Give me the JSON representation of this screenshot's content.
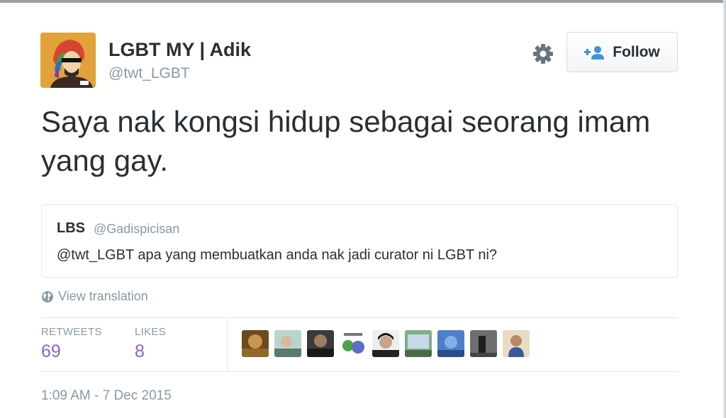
{
  "author": {
    "name": "LGBT MY | Adik",
    "handle": "@twt_LGBT"
  },
  "actions": {
    "follow_label": "Follow"
  },
  "tweet": {
    "text": "Saya nak kongsi hidup sebagai seorang imam yang gay."
  },
  "quoted_tweet": {
    "name": "LBS",
    "handle": "@Gadispicisan",
    "text": "@twt_LGBT apa yang membuatkan anda nak jadi curator ni LGBT ni?"
  },
  "translation": {
    "label": "View translation"
  },
  "stats": {
    "retweets_label": "RETWEETS",
    "retweets_count": "69",
    "likes_label": "LIKES",
    "likes_count": "8"
  },
  "timestamp": "1:09 AM - 7 Dec 2015",
  "colors": {
    "accent_purple": "#8a63c7",
    "muted_gray": "#8899a6",
    "text_dark": "#292f33",
    "border": "#e1e8ed",
    "follow_icon_blue": "#3b94d9"
  },
  "icons": {
    "settings": "gear-icon",
    "follow": "add-user-icon",
    "translate": "globe-icon"
  }
}
